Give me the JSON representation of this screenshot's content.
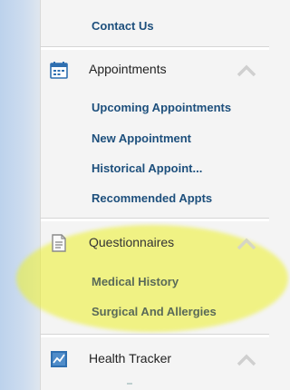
{
  "contact": {
    "label": "Contact Us"
  },
  "sections": [
    {
      "title": "Appointments",
      "icon": "calendar-icon",
      "items": [
        "Upcoming Appointments",
        "New Appointment",
        "Historical Appoint...",
        "Recommended Appts"
      ]
    },
    {
      "title": "Questionnaires",
      "icon": "document-icon",
      "items": [
        "Medical History",
        "Surgical And Allergies"
      ]
    },
    {
      "title": "Health Tracker",
      "icon": "chart-icon",
      "items": []
    }
  ],
  "colors": {
    "link": "#1d4f7c",
    "highlight": "#ecf028",
    "accent_blue": "#2f6fb0"
  }
}
